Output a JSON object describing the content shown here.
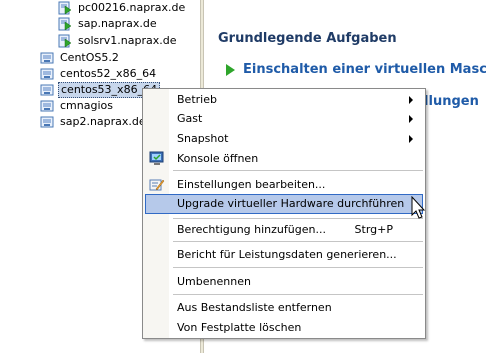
{
  "tree": {
    "items": [
      {
        "label": "pc00216.naprax.de",
        "kind": "vm-on"
      },
      {
        "label": "sap.naprax.de",
        "kind": "vm-on"
      },
      {
        "label": "solsrv1.naprax.de",
        "kind": "vm-on"
      },
      {
        "label": "CentOS5.2",
        "kind": "vm-off"
      },
      {
        "label": "centos52_x86_64",
        "kind": "vm-off"
      },
      {
        "label": "centos53_x86_64",
        "kind": "vm-off",
        "selected": true
      },
      {
        "label": "cmnagios",
        "kind": "vm-off"
      },
      {
        "label": "sap2.naprax.de",
        "kind": "vm-off"
      }
    ]
  },
  "main": {
    "section_title": "Grundlegende Aufgaben",
    "task1": "Einschalten einer virtuellen Masch",
    "task2": "tellungen"
  },
  "menu": {
    "items": [
      {
        "label": "Betrieb",
        "submenu": true
      },
      {
        "label": "Gast",
        "submenu": true
      },
      {
        "label": "Snapshot",
        "submenu": true
      },
      {
        "label": "Konsole öffnen",
        "icon": "console-icon"
      },
      {
        "label": "Einstellungen bearbeiten...",
        "icon": "edit-settings-icon"
      },
      {
        "label": "Upgrade virtueller Hardware durchführen",
        "highlighted": true
      },
      {
        "label": "Berechtigung hinzufügen...",
        "shortcut": "Strg+P"
      },
      {
        "label": "Bericht für Leistungsdaten generieren..."
      },
      {
        "label": "Umbenennen"
      },
      {
        "label": "Aus Bestandsliste entfernen"
      },
      {
        "label": "Von Festplatte löschen"
      }
    ]
  },
  "colors": {
    "selection": "#c8d7ec",
    "menu_highlight": "#b6c9ea",
    "task_link": "#1f5ba8",
    "power_on_green": "#2ea52b"
  }
}
